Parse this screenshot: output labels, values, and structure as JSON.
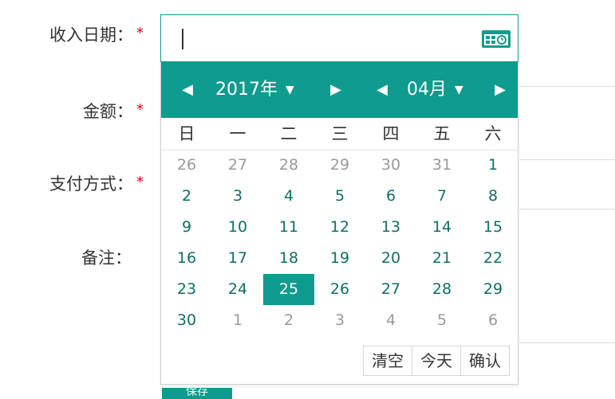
{
  "form": {
    "income_date_label": "收入日期",
    "amount_label": "金额",
    "payment_label": "支付方式",
    "note_label": "备注",
    "colon": "：",
    "required_mark": "*",
    "bottom_button_text": "保存"
  },
  "datepicker": {
    "input_value": "",
    "year_label": "2017年",
    "month_label": "04月",
    "weekdays": [
      "日",
      "一",
      "二",
      "三",
      "四",
      "五",
      "六"
    ],
    "weeks": [
      [
        {
          "d": "26",
          "o": true
        },
        {
          "d": "27",
          "o": true
        },
        {
          "d": "28",
          "o": true
        },
        {
          "d": "29",
          "o": true
        },
        {
          "d": "30",
          "o": true
        },
        {
          "d": "31",
          "o": true
        },
        {
          "d": "1",
          "o": false
        }
      ],
      [
        {
          "d": "2",
          "o": false
        },
        {
          "d": "3",
          "o": false
        },
        {
          "d": "4",
          "o": false
        },
        {
          "d": "5",
          "o": false
        },
        {
          "d": "6",
          "o": false
        },
        {
          "d": "7",
          "o": false
        },
        {
          "d": "8",
          "o": false
        }
      ],
      [
        {
          "d": "9",
          "o": false
        },
        {
          "d": "10",
          "o": false
        },
        {
          "d": "11",
          "o": false
        },
        {
          "d": "12",
          "o": false
        },
        {
          "d": "13",
          "o": false
        },
        {
          "d": "14",
          "o": false
        },
        {
          "d": "15",
          "o": false
        }
      ],
      [
        {
          "d": "16",
          "o": false
        },
        {
          "d": "17",
          "o": false
        },
        {
          "d": "18",
          "o": false
        },
        {
          "d": "19",
          "o": false
        },
        {
          "d": "20",
          "o": false
        },
        {
          "d": "21",
          "o": false
        },
        {
          "d": "22",
          "o": false
        }
      ],
      [
        {
          "d": "23",
          "o": false
        },
        {
          "d": "24",
          "o": false
        },
        {
          "d": "25",
          "o": false,
          "s": true
        },
        {
          "d": "26",
          "o": false
        },
        {
          "d": "27",
          "o": false
        },
        {
          "d": "28",
          "o": false
        },
        {
          "d": "29",
          "o": false
        }
      ],
      [
        {
          "d": "30",
          "o": false
        },
        {
          "d": "1",
          "o": true
        },
        {
          "d": "2",
          "o": true
        },
        {
          "d": "3",
          "o": true
        },
        {
          "d": "4",
          "o": true
        },
        {
          "d": "5",
          "o": true
        },
        {
          "d": "6",
          "o": true
        }
      ]
    ],
    "buttons": {
      "clear": "清空",
      "today": "今天",
      "confirm": "确认"
    },
    "icons": {
      "prev_year": "caret-left-icon",
      "next_year": "caret-right-icon",
      "prev_month": "caret-left-icon",
      "next_month": "caret-right-icon",
      "dropdown": "caret-down-icon",
      "calendar": "calendar-icon"
    }
  },
  "colors": {
    "accent": "#0f9b8e",
    "required": "#e60012",
    "other_month": "#999999",
    "day_text": "#0f6f66"
  }
}
